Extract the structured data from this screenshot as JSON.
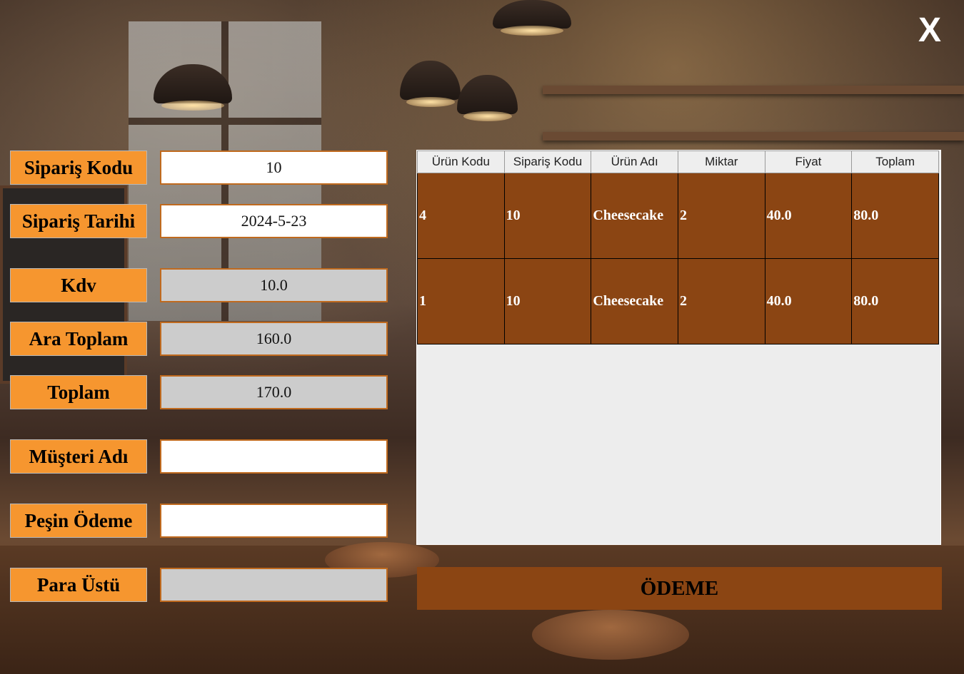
{
  "window": {
    "close_label": "X"
  },
  "form": {
    "siparis_kodu": {
      "label": "Sipariş Kodu",
      "value": "10"
    },
    "siparis_tarihi": {
      "label": "Sipariş Tarihi",
      "value": "2024-5-23"
    },
    "kdv": {
      "label": "Kdv",
      "value": "10.0"
    },
    "ara_toplam": {
      "label": "Ara Toplam",
      "value": "160.0"
    },
    "toplam": {
      "label": "Toplam",
      "value": "170.0"
    },
    "musteri_adi": {
      "label": "Müşteri Adı",
      "value": ""
    },
    "pesin_odeme": {
      "label": "Peşin Ödeme",
      "value": ""
    },
    "para_ustu": {
      "label": "Para Üstü",
      "value": ""
    }
  },
  "table": {
    "columns": [
      "Ürün Kodu",
      "Sipariş Kodu",
      "Ürün Adı",
      "Miktar",
      "Fiyat",
      "Toplam"
    ],
    "rows": [
      [
        "4",
        "10",
        "Cheesecake",
        "2",
        "40.0",
        "80.0"
      ],
      [
        "1",
        "10",
        "Cheesecake",
        "2",
        "40.0",
        "80.0"
      ]
    ],
    "row_color": "#8b4513"
  },
  "payment_button": {
    "label": "ÖDEME"
  },
  "colors": {
    "label_bg": "#f6962f",
    "accent": "#8b4513",
    "readonly_bg": "#cccccc"
  }
}
